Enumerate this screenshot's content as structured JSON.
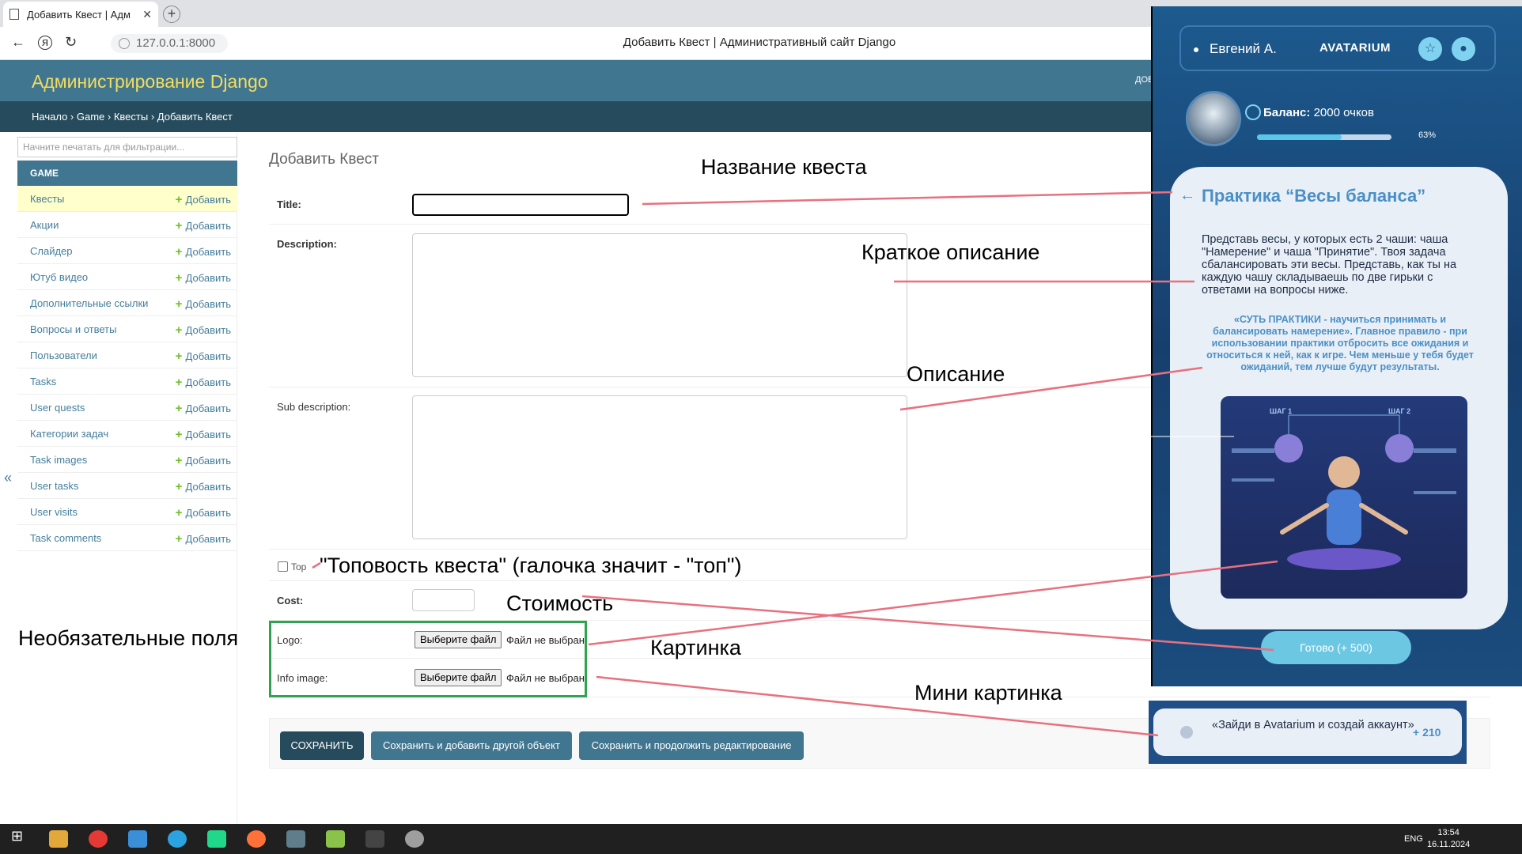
{
  "browser": {
    "tab_title": "Добавить Квест | Адм",
    "address": "127.0.0.1:8000",
    "page_title": "Добавить Квест | Административный сайт Django"
  },
  "django": {
    "brand": "Администрирование Django",
    "userlinks": "ДОБ",
    "breadcrumb": [
      "Начало",
      "Game",
      "Квесты",
      "Добавить Квест"
    ],
    "filter_placeholder": "Начните печатать для фильтрации...",
    "module": "GAME",
    "add_label": "Добавить",
    "models": [
      "Квесты",
      "Акции",
      "Слайдер",
      "Ютуб видео",
      "Дополнительные ссылки",
      "Вопросы и ответы",
      "Пользователи",
      "Tasks",
      "User quests",
      "Категории задач",
      "Task images",
      "User tasks",
      "User visits",
      "Task comments"
    ],
    "heading": "Добавить Квест",
    "fields": {
      "title": "Title:",
      "description": "Description:",
      "sub_description": "Sub description:",
      "top": "Top",
      "cost": "Cost:",
      "logo": "Logo:",
      "info_image": "Info image:"
    },
    "file_button": "Выберите файл",
    "file_none": "Файл не выбран",
    "buttons": {
      "save": "СОХРАНИТЬ",
      "save_add": "Сохранить и добавить другой объект",
      "save_continue": "Сохранить и продолжить редактирование"
    }
  },
  "annotations": {
    "title": "Название квеста",
    "short_desc": "Краткое описание",
    "desc": "Описание",
    "top": "\"Топовость квеста\" (галочка значит - \"топ\")",
    "cost": "Стоимость",
    "optional": "Необязательные поля",
    "image": "Картинка",
    "mini_image": "Мини картинка"
  },
  "phone": {
    "user": "Евгений А.",
    "logo": "AVATARIUM",
    "balance_label": "Баланс:",
    "balance_value": "2000 очков",
    "progress_pct": 63,
    "progress_label": "63%",
    "card_title": "Практика “Весы баланса”",
    "card_text": "Представь весы, у которых есть 2 чаши: чаша \"Намерение\" и чаша \"Принятие\". Твоя задача сбалансировать эти весы. Представь, как ты на каждую чашу складываешь  по две гирьки с ответами на вопросы ниже.",
    "card_quote": "«СУТЬ ПРАКТИКИ - научиться принимать и балансировать намерение». Главное правило - при использовании практики отбросить все ожидания и относиться к ней, как к игре. Чем меньше у тебя будет ожиданий, тем лучше будут результаты.",
    "step1": "ШАГ 1",
    "step2": "ШАГ 2",
    "done_button": "Готово  (+ 500)",
    "mini_text": "«Зайди в Avatarium и создай аккаунт»",
    "mini_points": "+ 210"
  },
  "taskbar": {
    "lang": "ENG",
    "time": "13:54",
    "date": "16.11.2024"
  }
}
